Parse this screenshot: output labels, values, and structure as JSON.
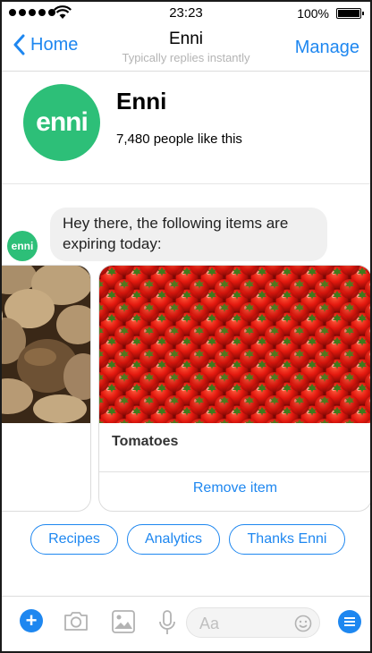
{
  "status_bar": {
    "time": "23:23",
    "battery": "100%"
  },
  "nav": {
    "back_label": "Home",
    "title": "Enni",
    "subtitle": "Typically replies instantly",
    "manage_label": "Manage"
  },
  "page": {
    "logo_text": "enni",
    "name": "Enni",
    "likes": "7,480 people like this"
  },
  "chat": {
    "avatar_text": "enni",
    "message": "Hey there, the following items are expiring today:"
  },
  "cards": [
    {
      "title": "",
      "image": "mushrooms"
    },
    {
      "title": "Tomatoes",
      "image": "tomatoes",
      "action": "Remove item"
    }
  ],
  "quick_replies": [
    "Recipes",
    "Analytics",
    "Thanks Enni"
  ],
  "composer": {
    "placeholder": "Aa"
  },
  "colors": {
    "accent": "#1e87f0",
    "brand_green": "#2dbf78"
  }
}
